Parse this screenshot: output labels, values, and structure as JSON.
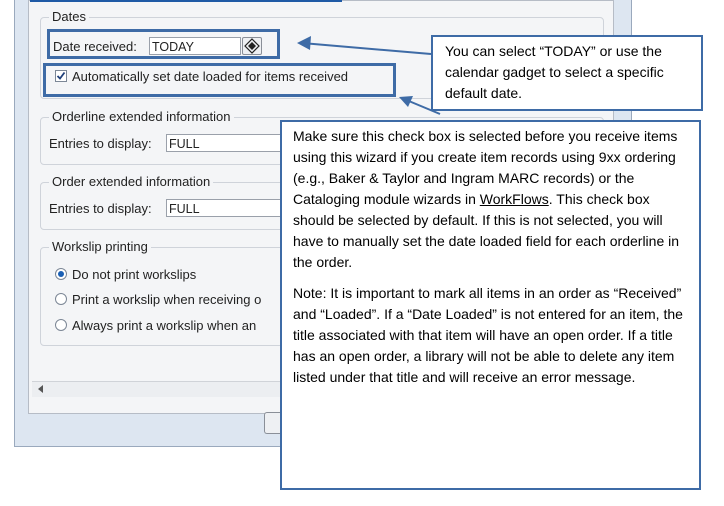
{
  "dates": {
    "title": "Dates",
    "date_received_label": "Date received:",
    "date_received_value": "TODAY",
    "auto_date_label": "Automatically set date loaded for items received",
    "auto_date_checked": true
  },
  "orderline_ext": {
    "title": "Orderline extended information",
    "entries_label": "Entries to display:",
    "entries_value": "FULL"
  },
  "order_ext": {
    "title": "Order extended information",
    "entries_label": "Entries to display:",
    "entries_value": "FULL"
  },
  "workslip": {
    "title": "Workslip printing",
    "options": [
      {
        "label": "Do not print workslips",
        "selected": true
      },
      {
        "label": "Print a workslip when receiving o",
        "selected": false
      },
      {
        "label": "Always print a workslip when an",
        "selected": false
      }
    ]
  },
  "callouts": {
    "today": "You can select “TODAY” or use the calendar gadget to select a specific default date.",
    "checkbox_p1_a": "Make sure this check box is selected before you receive items using this wizard if you create item records using 9xx ordering (e.g., Baker & Taylor and Ingram MARC records) or the Cataloging module wizards in ",
    "checkbox_p1_link": "WorkFlows",
    "checkbox_p1_b": ". This check box should be selected by default. If this is not selected, you will have to manually set the date loaded field for each orderline in the order.",
    "checkbox_p2": "Note: It is important to mark all items in an order as “Received” and “Loaded”. If a “Date Loaded” is not entered for an item, the title associated with that item will have an open order. If a title has an open order, a library will not be able to delete any item listed under that title and will receive an error message."
  },
  "colors": {
    "callout_border": "#3e6ba6",
    "radio_selected": "#1a5fb4"
  }
}
